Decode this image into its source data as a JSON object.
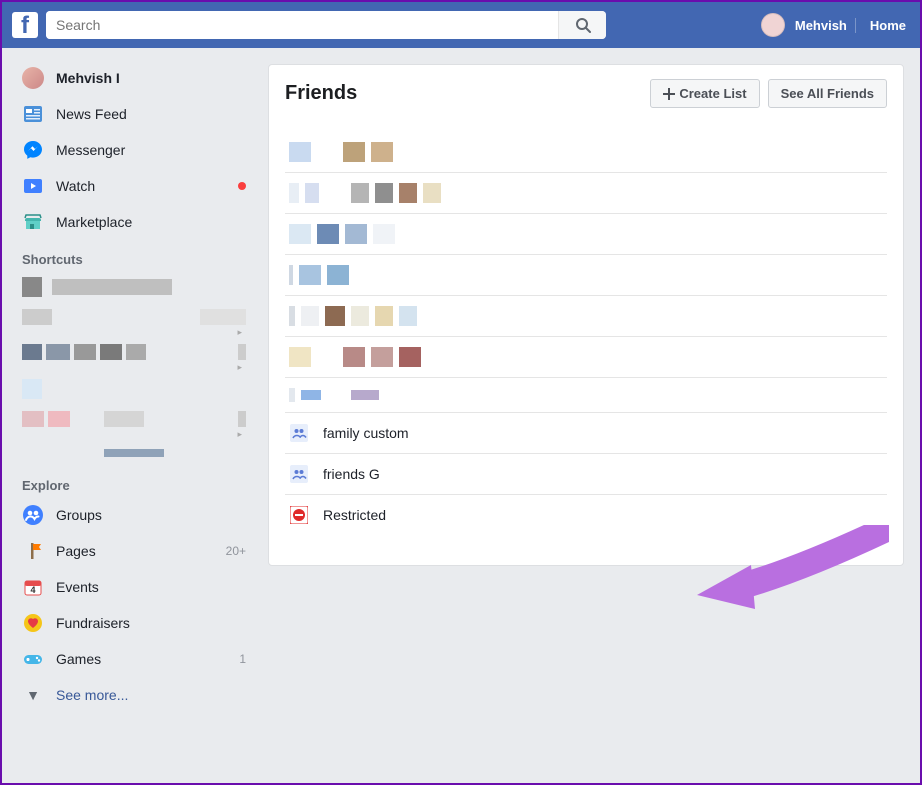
{
  "header": {
    "search_placeholder": "Search",
    "user_name": "Mehvish",
    "home_label": "Home"
  },
  "sidebar": {
    "profile_name": "Mehvish I",
    "nav": [
      {
        "id": "newsfeed",
        "label": "News Feed",
        "badge": "",
        "dot": false
      },
      {
        "id": "messenger",
        "label": "Messenger",
        "badge": "",
        "dot": false
      },
      {
        "id": "watch",
        "label": "Watch",
        "badge": "",
        "dot": true
      },
      {
        "id": "marketplace",
        "label": "Marketplace",
        "badge": "",
        "dot": false
      }
    ],
    "section_shortcuts": "Shortcuts",
    "section_explore": "Explore",
    "explore": [
      {
        "id": "groups",
        "label": "Groups",
        "badge": ""
      },
      {
        "id": "pages",
        "label": "Pages",
        "badge": "20+"
      },
      {
        "id": "events",
        "label": "Events",
        "badge": ""
      },
      {
        "id": "fundraisers",
        "label": "Fundraisers",
        "badge": ""
      },
      {
        "id": "games",
        "label": "Games",
        "badge": "1"
      }
    ],
    "see_more": "See more..."
  },
  "main": {
    "title": "Friends",
    "create_list_label": "Create List",
    "see_all_label": "See All Friends",
    "lists": [
      {
        "id": "family-custom",
        "label": "family custom",
        "icon": "friends"
      },
      {
        "id": "friends-g",
        "label": "friends G",
        "icon": "friends"
      },
      {
        "id": "restricted",
        "label": "Restricted",
        "icon": "restricted"
      }
    ]
  }
}
